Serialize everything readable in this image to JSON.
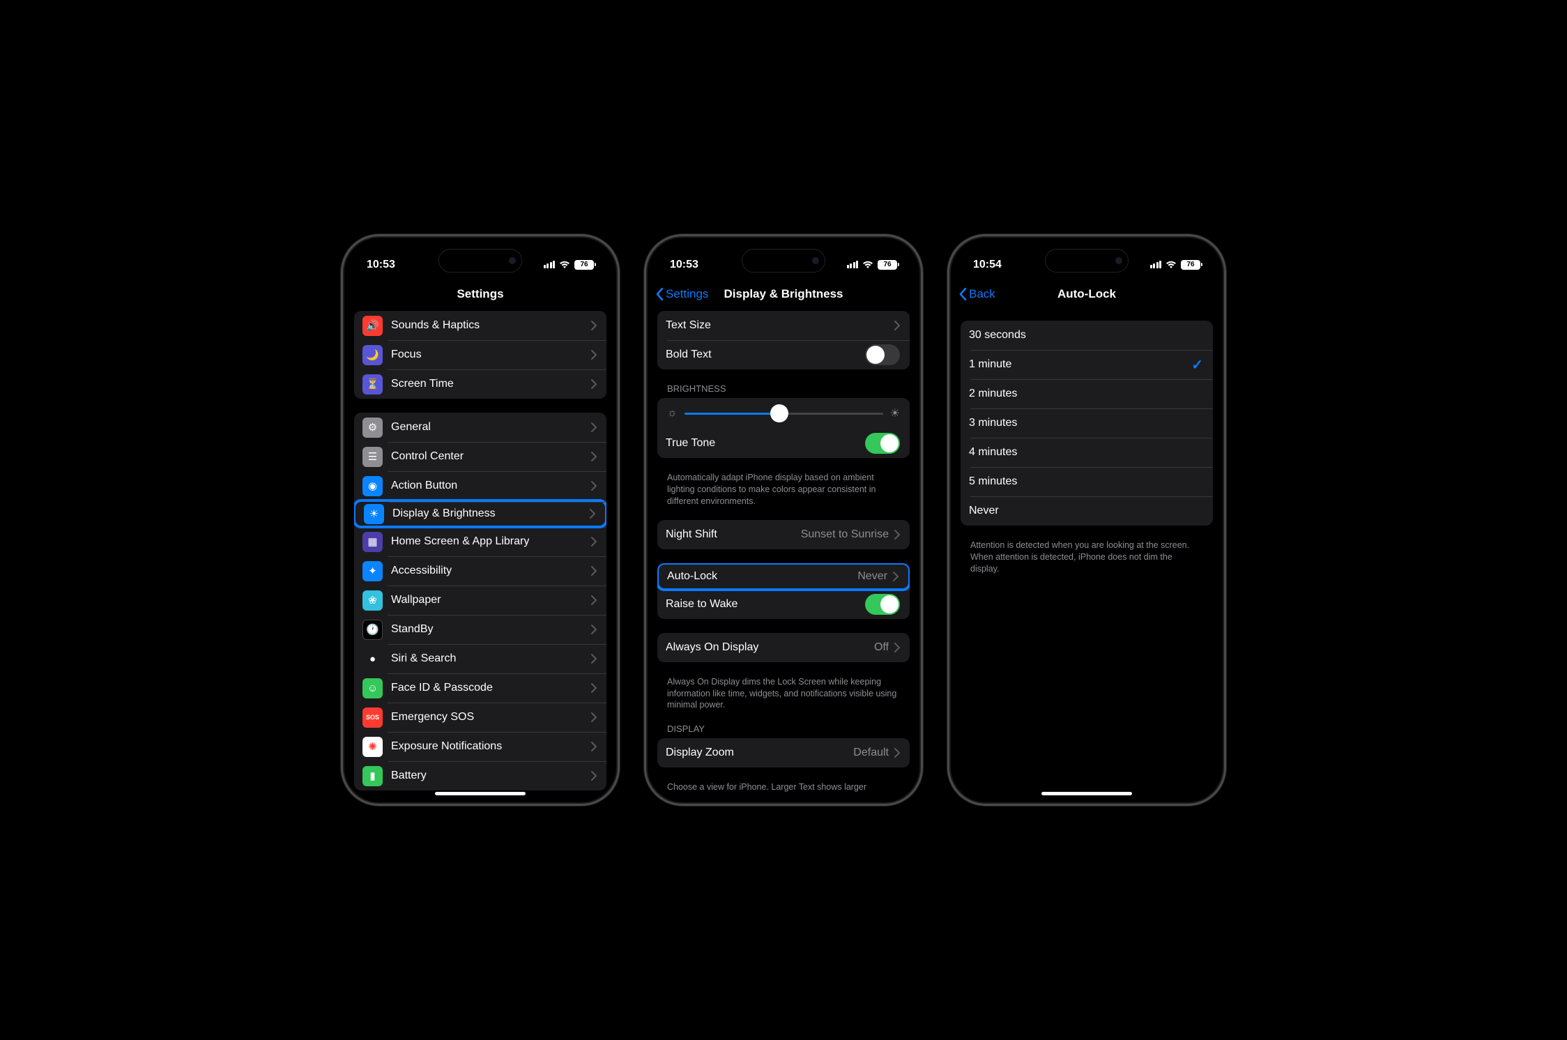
{
  "phone1": {
    "time": "10:53",
    "battery": "76",
    "title": "Settings",
    "group1": [
      {
        "icon": "sounds-icon",
        "bg": "#ff3b30",
        "glyph": "🔊",
        "label": "Sounds & Haptics"
      },
      {
        "icon": "focus-icon",
        "bg": "#5856d6",
        "glyph": "🌙",
        "label": "Focus"
      },
      {
        "icon": "screentime-icon",
        "bg": "#5856d6",
        "glyph": "⏳",
        "label": "Screen Time"
      }
    ],
    "group2": [
      {
        "icon": "general-icon",
        "bg": "#8e8e93",
        "glyph": "⚙",
        "label": "General"
      },
      {
        "icon": "control-center-icon",
        "bg": "#8e8e93",
        "glyph": "☰",
        "label": "Control Center"
      },
      {
        "icon": "action-button-icon",
        "bg": "#0a84ff",
        "glyph": "◉",
        "label": "Action Button"
      },
      {
        "icon": "display-icon",
        "bg": "#0a84ff",
        "glyph": "☀",
        "label": "Display & Brightness",
        "highlight": true
      },
      {
        "icon": "home-screen-icon",
        "bg": "#4b3ea8",
        "glyph": "▦",
        "label": "Home Screen & App Library"
      },
      {
        "icon": "accessibility-icon",
        "bg": "#0a84ff",
        "glyph": "✦",
        "label": "Accessibility"
      },
      {
        "icon": "wallpaper-icon",
        "bg": "#33c1de",
        "glyph": "❀",
        "label": "Wallpaper"
      },
      {
        "icon": "standby-icon",
        "bg": "#000",
        "glyph": "🕐",
        "label": "StandBy"
      },
      {
        "icon": "siri-icon",
        "bg": "#1c1c1e",
        "glyph": "●",
        "label": "Siri & Search"
      },
      {
        "icon": "faceid-icon",
        "bg": "#34c759",
        "glyph": "☺",
        "label": "Face ID & Passcode"
      },
      {
        "icon": "sos-icon",
        "bg": "#ff3b30",
        "glyph": "SOS",
        "label": "Emergency SOS"
      },
      {
        "icon": "exposure-icon",
        "bg": "#fff",
        "glyph": "✺",
        "label": "Exposure Notifications"
      },
      {
        "icon": "battery-icon",
        "bg": "#34c759",
        "glyph": "▮",
        "label": "Battery"
      }
    ]
  },
  "phone2": {
    "time": "10:53",
    "battery": "76",
    "backLabel": "Settings",
    "title": "Display & Brightness",
    "textSizeLabel": "Text Size",
    "boldTextLabel": "Bold Text",
    "brightnessHeader": "BRIGHTNESS",
    "trueToneLabel": "True Tone",
    "trueToneFooter": "Automatically adapt iPhone display based on ambient lighting conditions to make colors appear consistent in different environments.",
    "nightShiftLabel": "Night Shift",
    "nightShiftValue": "Sunset to Sunrise",
    "autoLockLabel": "Auto-Lock",
    "autoLockValue": "Never",
    "raiseToWakeLabel": "Raise to Wake",
    "alwaysOnLabel": "Always On Display",
    "alwaysOnValue": "Off",
    "alwaysOnFooter": "Always On Display dims the Lock Screen while keeping information like time, widgets, and notifications visible using minimal power.",
    "displayHeader": "DISPLAY",
    "displayZoomLabel": "Display Zoom",
    "displayZoomValue": "Default",
    "displayZoomFooter": "Choose a view for iPhone. Larger Text shows larger"
  },
  "phone3": {
    "time": "10:54",
    "battery": "76",
    "backLabel": "Back",
    "title": "Auto-Lock",
    "options": [
      {
        "label": "30 seconds",
        "selected": false
      },
      {
        "label": "1 minute",
        "selected": true
      },
      {
        "label": "2 minutes",
        "selected": false
      },
      {
        "label": "3 minutes",
        "selected": false
      },
      {
        "label": "4 minutes",
        "selected": false
      },
      {
        "label": "5 minutes",
        "selected": false
      },
      {
        "label": "Never",
        "selected": false
      }
    ],
    "footer": "Attention is detected when you are looking at the screen. When attention is detected, iPhone does not dim the display."
  }
}
